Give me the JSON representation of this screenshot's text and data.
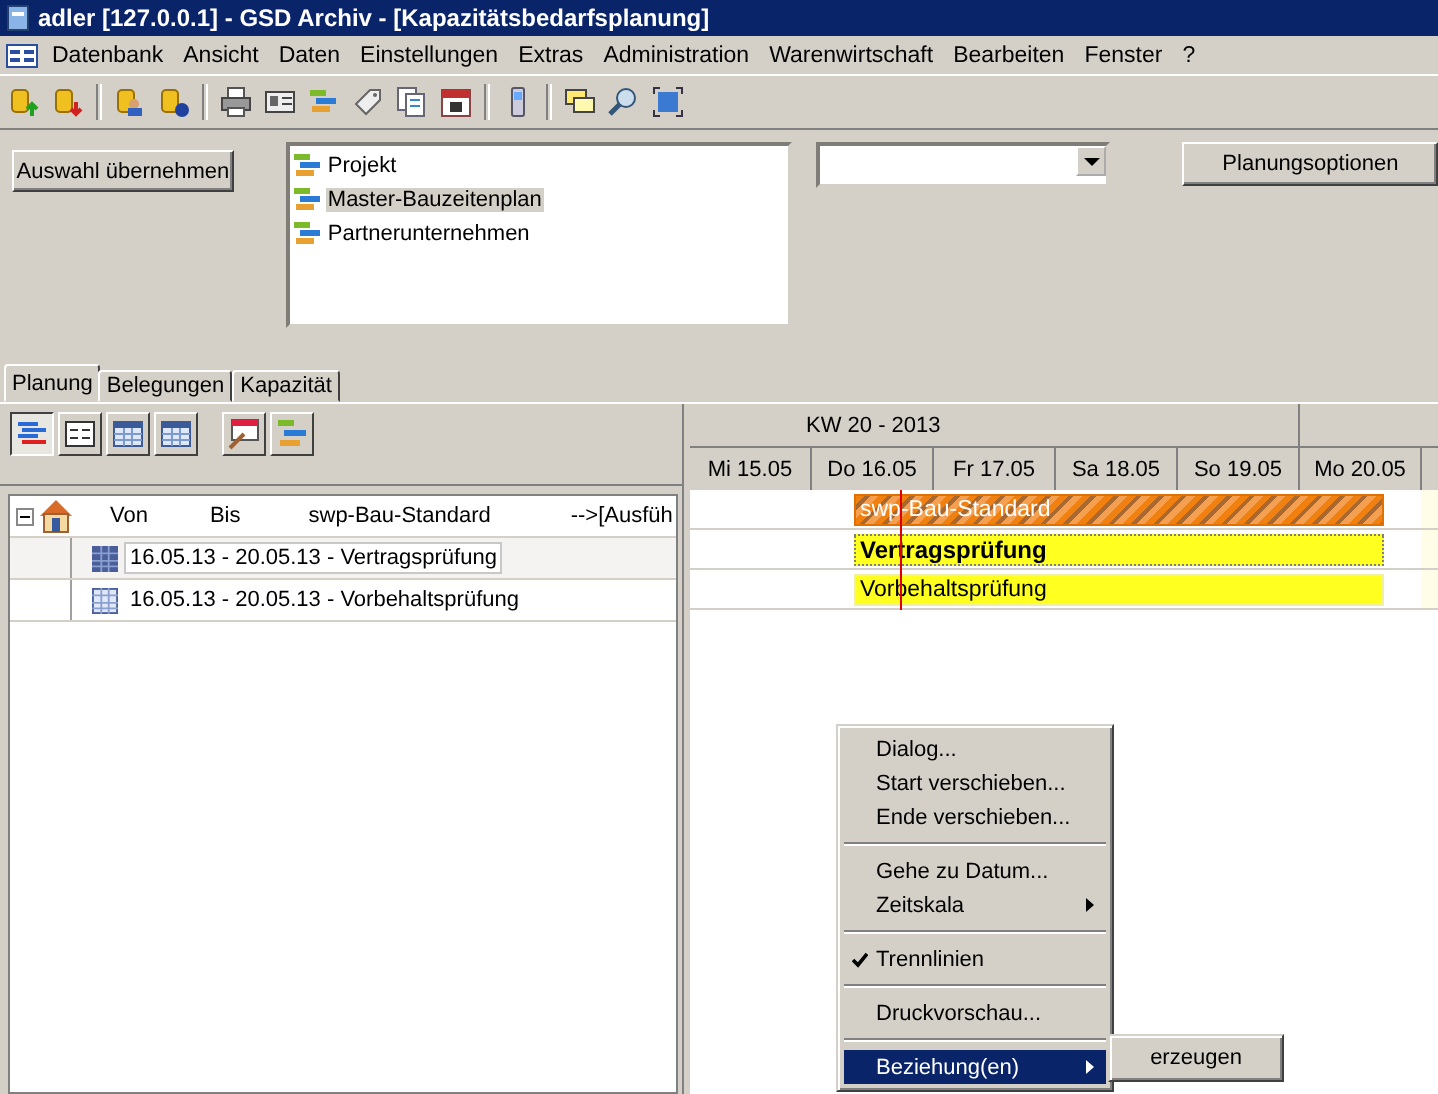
{
  "window": {
    "title": "adler [127.0.0.1] - GSD Archiv - [Kapazitätsbedarfsplanung]"
  },
  "menu": [
    "Datenbank",
    "Ansicht",
    "Daten",
    "Einstellungen",
    "Extras",
    "Administration",
    "Warenwirtschaft",
    "Bearbeiten",
    "Fenster",
    "?"
  ],
  "top_panel": {
    "apply_button": "Auswahl übernehmen",
    "list": [
      {
        "label": "Projekt",
        "selected": false
      },
      {
        "label": "Master-Bauzeitenplan",
        "selected": true
      },
      {
        "label": "Partnerunternehmen",
        "selected": false
      }
    ],
    "options_button": "Planungsoptionen"
  },
  "tabs": [
    {
      "label": "Planung",
      "selected": true
    },
    {
      "label": "Belegungen",
      "selected": false
    },
    {
      "label": "Kapazität",
      "selected": false
    }
  ],
  "tree": {
    "expanded": true,
    "columns": [
      "Von",
      "Bis",
      "swp-Bau-Standard",
      "-->[Ausfüh"
    ],
    "rows": [
      {
        "label": "16.05.13 - 20.05.13 - Vertragsprüfung",
        "selected": true
      },
      {
        "label": "16.05.13 - 20.05.13 - Vorbehaltsprüfung",
        "selected": false
      }
    ]
  },
  "gantt": {
    "week": "KW 20 - 2013",
    "days": [
      "Mi 15.05",
      "Do 16.05",
      "Fr 17.05",
      "Sa 18.05",
      "So 19.05",
      "Mo 20.05"
    ],
    "bars": [
      {
        "label": "swp-Bau-Standard",
        "kind": "summary"
      },
      {
        "label": "Vertragsprüfung",
        "kind": "task",
        "selected": true
      },
      {
        "label": "Vorbehaltsprüfung",
        "kind": "task",
        "selected": false
      }
    ]
  },
  "context_menu": [
    {
      "kind": "item",
      "label": "Dialog..."
    },
    {
      "kind": "item",
      "label": "Start verschieben..."
    },
    {
      "kind": "item",
      "label": "Ende verschieben..."
    },
    {
      "kind": "separator"
    },
    {
      "kind": "item",
      "label": "Gehe zu Datum..."
    },
    {
      "kind": "submenu",
      "label": "Zeitskala",
      "selected": false
    },
    {
      "kind": "separator"
    },
    {
      "kind": "check",
      "label": "Trennlinien",
      "checked": true
    },
    {
      "kind": "separator"
    },
    {
      "kind": "item",
      "label": "Druckvorschau..."
    },
    {
      "kind": "separator"
    },
    {
      "kind": "submenu",
      "label": "Beziehung(en)",
      "selected": true
    }
  ],
  "submenu": [
    "erzeugen"
  ]
}
